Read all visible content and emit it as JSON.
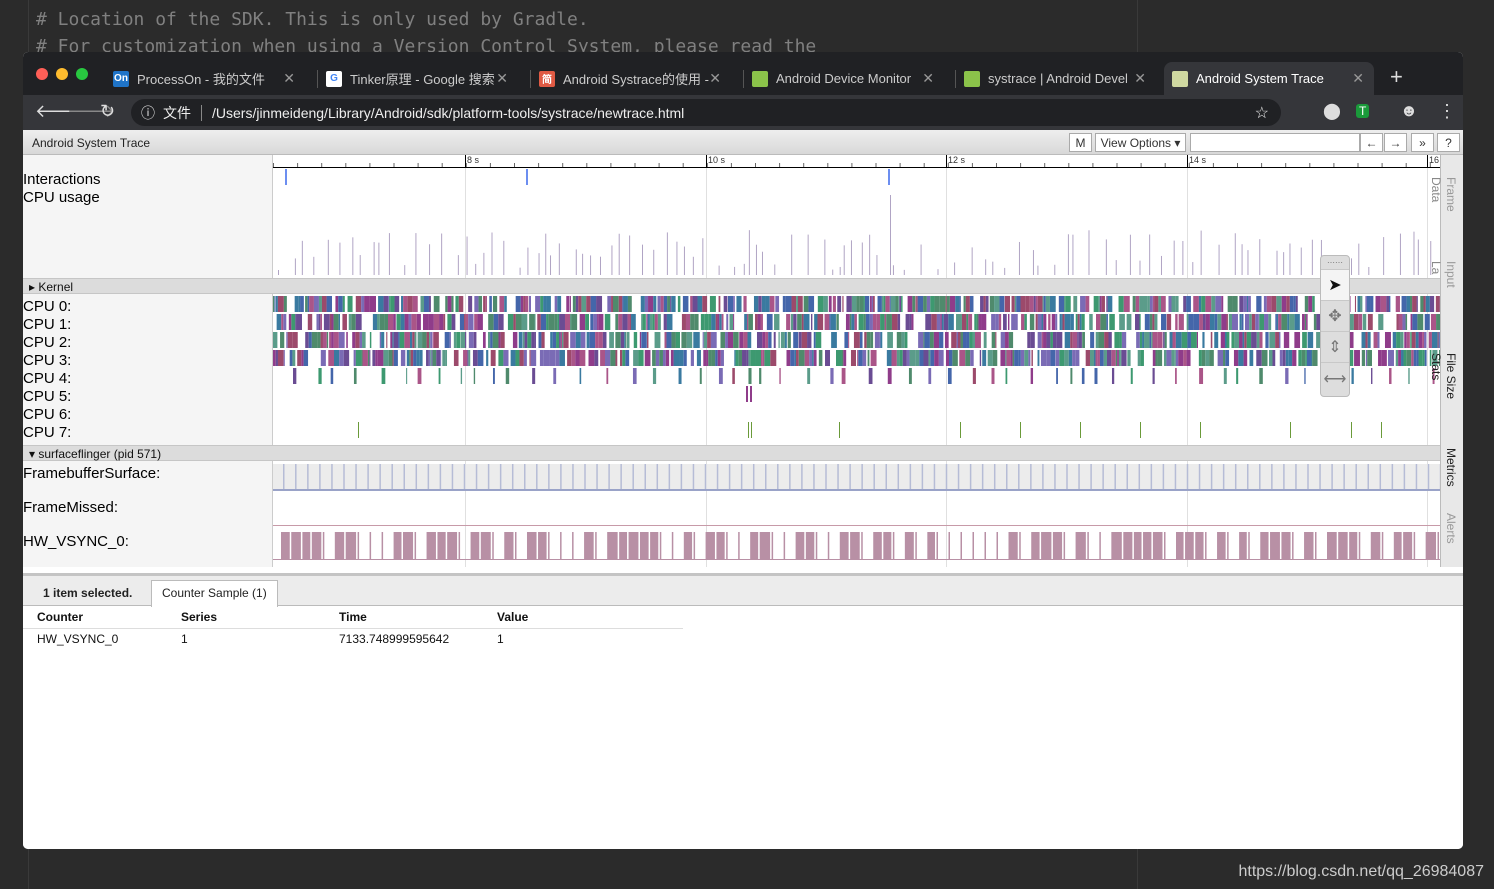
{
  "editor_lines": [
    "# Location of the SDK. This is only used by Gradle.",
    "# For customization when using a Version Control System, please read the"
  ],
  "watermark": "https://blog.csdn.net/qq_26984087",
  "browser": {
    "tabs": [
      {
        "label": "ProcessOn - 我的文件",
        "icon": "processon-icon",
        "fav": "On",
        "color": "#1f74c8"
      },
      {
        "label": "Tinker原理 - Google 搜索",
        "icon": "google-icon",
        "fav": "G",
        "color": "#ffffff"
      },
      {
        "label": "Android Systrace的使用 - ",
        "icon": "jianshu-icon",
        "fav": "简",
        "color": "#e05a44"
      },
      {
        "label": "Android Device Monitor",
        "icon": "android-icon",
        "fav": "",
        "color": "#8bc34a"
      },
      {
        "label": "systrace | Android Devel",
        "icon": "android-icon",
        "fav": "",
        "color": "#8bc34a"
      },
      {
        "label": "Android System Trace",
        "icon": "trace-icon",
        "fav": "",
        "color": "#cfd8a0",
        "active": true
      }
    ],
    "address_prefix": "文件",
    "url": "/Users/jinmeideng/Library/Android/sdk/platform-tools/systrace/newtrace.html"
  },
  "app": {
    "title": "Android System Trace",
    "m_button": "M",
    "view_options": "View Options ▾",
    "search_value": "",
    "prev": "←",
    "next": "→",
    "more": "»",
    "help": "?"
  },
  "ruler": {
    "ticks": [
      "8 s",
      "10 s",
      "12 s",
      "14 s",
      "16"
    ]
  },
  "tracks": {
    "interactions": "Interactions",
    "cpu_usage": "CPU usage",
    "kernel": "Kernel",
    "cpus": [
      "CPU 0:",
      "CPU 1:",
      "CPU 2:",
      "CPU 3:",
      "CPU 4:",
      "CPU 5:",
      "CPU 6:",
      "CPU 7:"
    ],
    "process": "surfaceflinger (pid 571)",
    "counters": [
      "FramebufferSurface:",
      "FrameMissed:",
      "HW_VSYNC_0:"
    ]
  },
  "side_tabs": [
    "Frame Data",
    "Input Latency",
    "File Size Stats",
    "Metrics",
    "Alerts"
  ],
  "side_inner": [
    "Data",
    "La",
    "Stats"
  ],
  "side_outer": [
    "Frame",
    "Input",
    "File Size",
    "Metrics",
    "Alerts"
  ],
  "bottom": {
    "selection": "1 item selected.",
    "tab": "Counter Sample (1)",
    "columns": [
      "Counter",
      "Series",
      "Time",
      "Value"
    ],
    "rows": [
      [
        "HW_VSYNC_0",
        "1",
        "7133.748999595642",
        "1"
      ]
    ]
  }
}
